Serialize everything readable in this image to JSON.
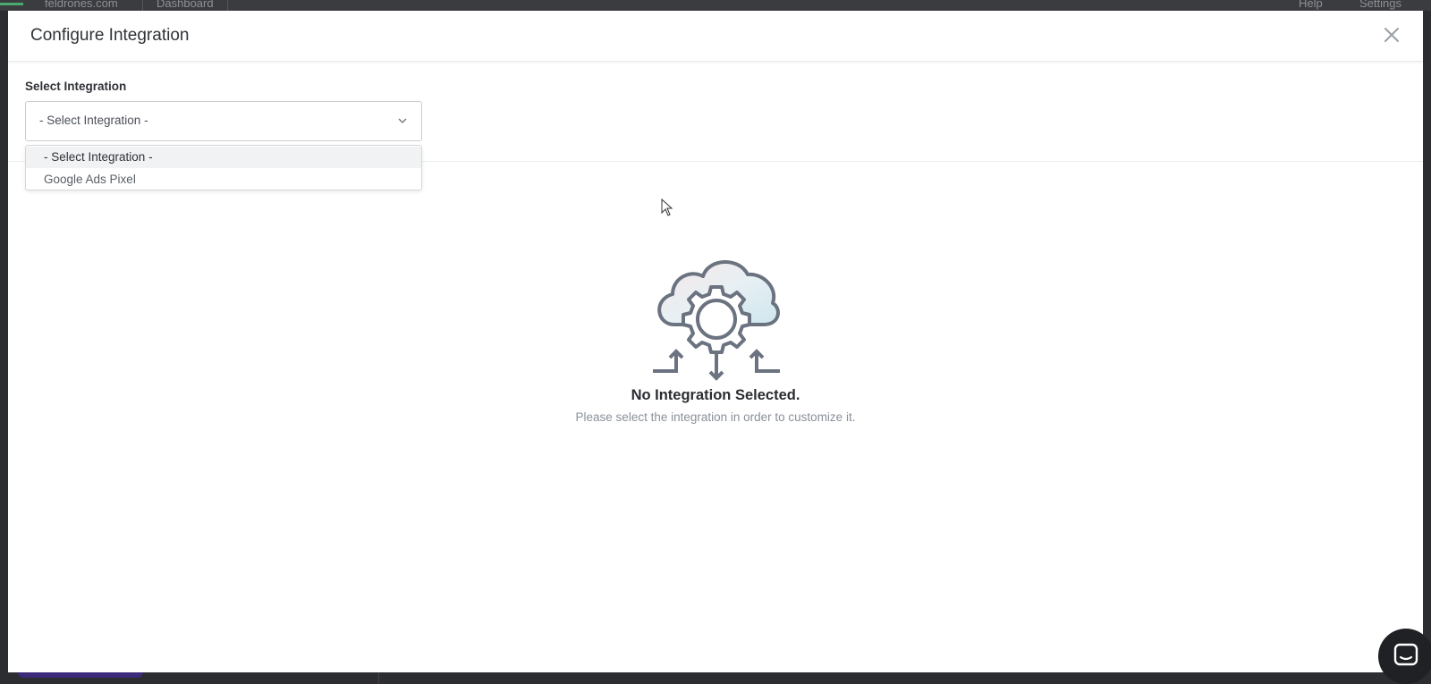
{
  "background": {
    "site_selector": "feldrones.com",
    "dashboard_tab": "Dashboard",
    "help_menu": "Help",
    "settings_menu": "Settings"
  },
  "modal": {
    "title": "Configure Integration",
    "close_icon": "close-icon"
  },
  "integration_select": {
    "label": "Select Integration",
    "value": "- Select Integration -",
    "options": [
      "- Select Integration -",
      "Google Ads Pixel"
    ],
    "selected_index": 0
  },
  "empty_state": {
    "icon": "cloud-gear-icon",
    "title": "No Integration Selected.",
    "description": "Please select the integration in order to customize it."
  },
  "colors": {
    "modal_bg": "#ffffff",
    "overlay": "#2b2d30",
    "icon_stroke": "#6b7280",
    "chat_launcher": "#202124"
  }
}
